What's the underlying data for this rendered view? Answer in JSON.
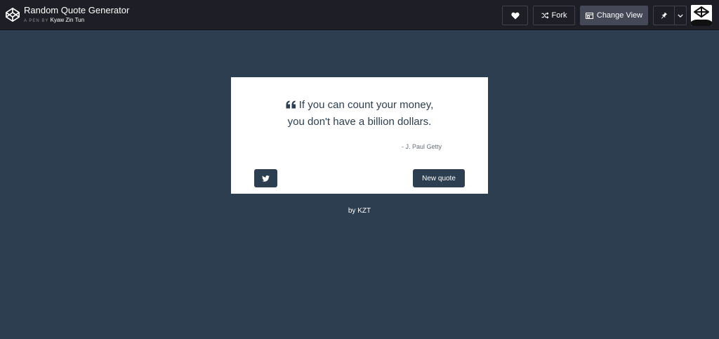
{
  "header": {
    "pen_title": "Random Quote Generator",
    "byline_prefix": "A PEN BY",
    "author": "Kyaw Zin Tun",
    "buttons": {
      "fork_label": "Fork",
      "change_view_label": "Change View"
    }
  },
  "quote": {
    "line1": "If you can count your money,",
    "line2": "you don't have a billion dollars.",
    "author": "J. Paul Getty",
    "new_quote_label": "New quote"
  },
  "footer": {
    "credit": "by KZT"
  },
  "colors": {
    "background": "#2c3e50",
    "topbar": "#1e1f26",
    "card": "#ffffff",
    "accent": "#2c3e50"
  },
  "icons": [
    "codepen-logo-icon",
    "heart-icon",
    "fork-icon",
    "change-view-icon",
    "pin-icon",
    "chevron-down-icon",
    "quote-left-icon",
    "twitter-icon"
  ]
}
